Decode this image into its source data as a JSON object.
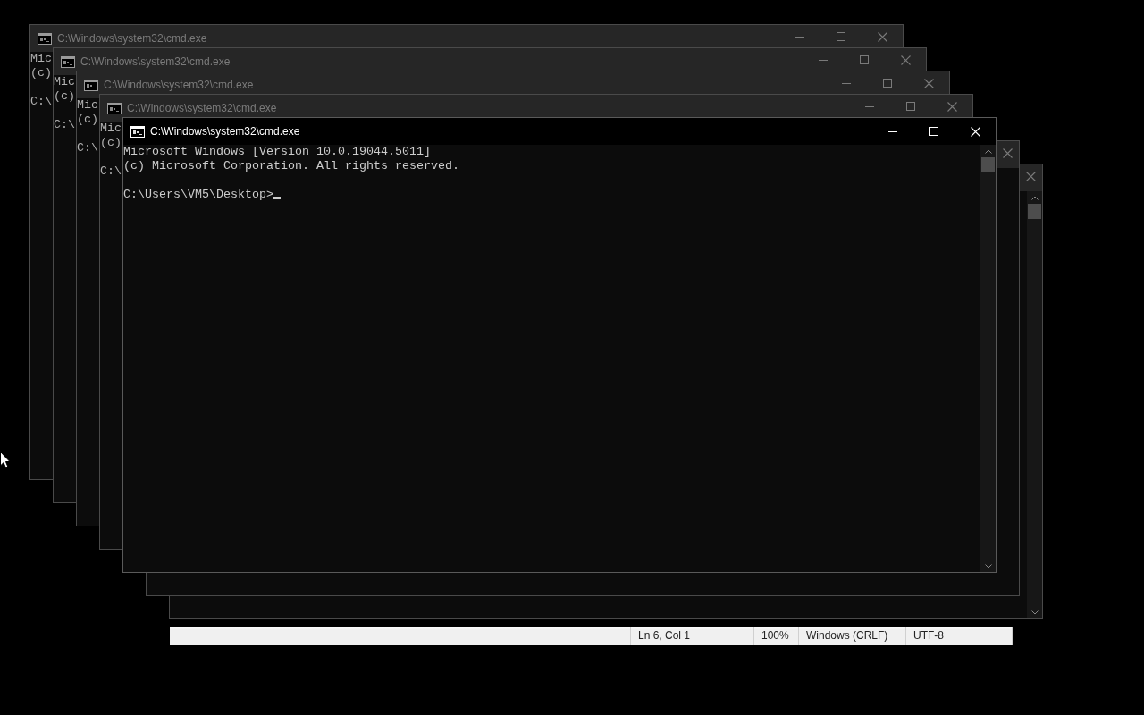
{
  "windows": [
    {
      "title": "C:\\Windows\\system32\\cmd.exe",
      "active": false,
      "buttons": [
        {
          "kind": "minimize"
        },
        {
          "kind": "maximize"
        },
        {
          "kind": "close"
        }
      ],
      "lines": [
        "Mic",
        "(c)"
      ],
      "prompt": "C:\\"
    },
    {
      "title": "C:\\Windows\\system32\\cmd.exe",
      "active": false,
      "buttons": [
        {
          "kind": "minimize"
        },
        {
          "kind": "maximize"
        },
        {
          "kind": "close"
        }
      ],
      "lines": [
        "Mic",
        "(c)"
      ],
      "prompt": "C:\\"
    },
    {
      "title": "C:\\Windows\\system32\\cmd.exe",
      "active": false,
      "buttons": [
        {
          "kind": "minimize"
        },
        {
          "kind": "maximize"
        },
        {
          "kind": "close"
        }
      ],
      "lines": [
        "Mic",
        "(c)"
      ],
      "prompt": "C:\\"
    },
    {
      "title": "C:\\Windows\\system32\\cmd.exe",
      "active": false,
      "buttons": [
        {
          "kind": "minimize"
        },
        {
          "kind": "maximize"
        },
        {
          "kind": "close"
        }
      ],
      "lines": [
        "Mic",
        "(c)"
      ],
      "prompt": "C:\\"
    },
    {
      "title": "C:\\Windows\\system32\\cmd.exe",
      "active": true,
      "buttons": [
        {
          "kind": "minimize"
        },
        {
          "kind": "maximize"
        },
        {
          "kind": "close"
        }
      ],
      "lines": [
        "Microsoft Windows [Version 10.0.19044.5011]",
        "(c) Microsoft Corporation. All rights reserved."
      ],
      "prompt": "C:\\Users\\VM5\\Desktop>",
      "scrollbar": {
        "kind": "vertical"
      }
    },
    {
      "active": false,
      "buttons": [
        {
          "kind": "close"
        }
      ]
    },
    {
      "active": false,
      "buttons": [
        {
          "kind": "close"
        }
      ],
      "scrollbar": {
        "kind": "vertical"
      }
    }
  ],
  "status_bar": {
    "items": [
      "Ln 6, Col 1",
      "100%",
      "Windows (CRLF)",
      "UTF-8"
    ]
  }
}
